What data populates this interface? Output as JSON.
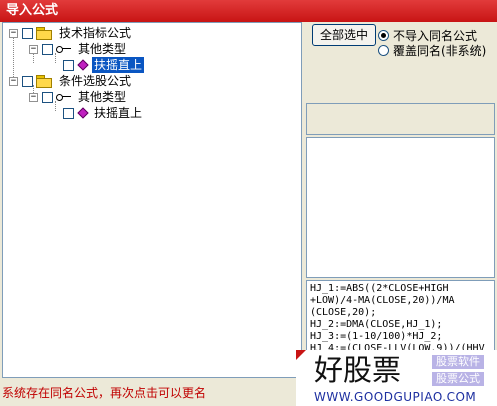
{
  "window": {
    "title": "导入公式"
  },
  "tree": {
    "groups": [
      {
        "label": "技术指标公式",
        "child": {
          "label": "其他类型",
          "formula": "扶摇直上",
          "selected": true
        }
      },
      {
        "label": "条件选股公式",
        "child": {
          "label": "其他类型",
          "formula": "扶摇直上",
          "selected": false
        }
      }
    ]
  },
  "options": {
    "select_all_label": "全部选中",
    "radio_skip_label": "不导入同名公式",
    "radio_overwrite_label": "覆盖同名(非系统)",
    "selected": "skip"
  },
  "code_preview": {
    "lines": [
      "HJ_1:=ABS((2*CLOSE+HIGH",
      "+LOW)/4-MA(CLOSE,20))/MA",
      "(CLOSE,20);",
      "HJ_2:=DMA(CLOSE,HJ_1);",
      "HJ_3:=(1-10/100)*HJ_2;",
      "HJ_4:=(CLOSE-LLV(LOW,9))/(HHV"
    ]
  },
  "status": {
    "message": "系统存在同名公式，再次点击可以更名"
  },
  "watermark": {
    "title": "好股票",
    "tag1": "股票软件",
    "tag2": "股票公式",
    "url": "WWW.GOODGUPIAO.COM"
  },
  "colors": {
    "titlebar": "#c81414",
    "selection": "#0a56c2",
    "status_text": "#c00000"
  }
}
